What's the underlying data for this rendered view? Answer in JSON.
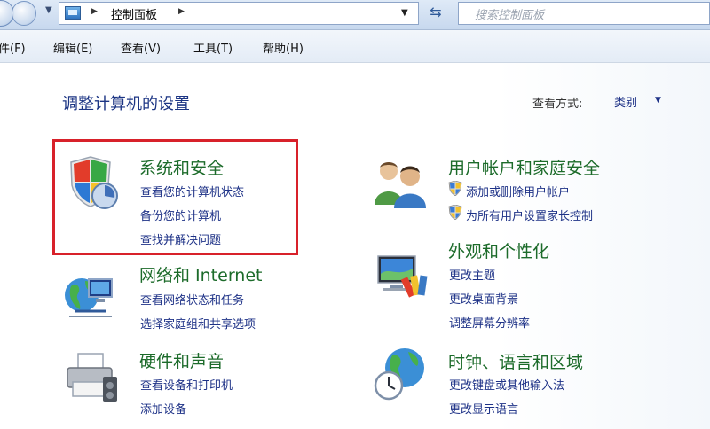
{
  "address_bar": {
    "path_label": "控制面板",
    "search_placeholder": "搜索控制面板"
  },
  "menu": [
    {
      "label": "件(F)"
    },
    {
      "label": "编辑(E)"
    },
    {
      "label": "查看(V)"
    },
    {
      "label": "工具(T)"
    },
    {
      "label": "帮助(H)"
    }
  ],
  "main": {
    "title": "调整计算机的设置",
    "view_by_label": "查看方式:",
    "view_by_value": "类别"
  },
  "categories": [
    {
      "title": "系统和安全",
      "icon": "shield-icon",
      "links": [
        "查看您的计算机状态",
        "备份您的计算机",
        "查找并解决问题"
      ]
    },
    {
      "title": "网络和 Internet",
      "icon": "network-icon",
      "links": [
        "查看网络状态和任务",
        "选择家庭组和共享选项"
      ]
    },
    {
      "title": "硬件和声音",
      "icon": "printer-icon",
      "links": [
        "查看设备和打印机",
        "添加设备"
      ]
    },
    {
      "title": "用户帐户和家庭安全",
      "icon": "users-icon",
      "links": [
        "添加或删除用户帐户",
        "为所有用户设置家长控制"
      ]
    },
    {
      "title": "外观和个性化",
      "icon": "monitor-paint-icon",
      "links": [
        "更改主题",
        "更改桌面背景",
        "调整屏幕分辨率"
      ]
    },
    {
      "title": "时钟、语言和区域",
      "icon": "globe-clock-icon",
      "links": [
        "更改键盘或其他输入法",
        "更改显示语言"
      ]
    }
  ]
}
